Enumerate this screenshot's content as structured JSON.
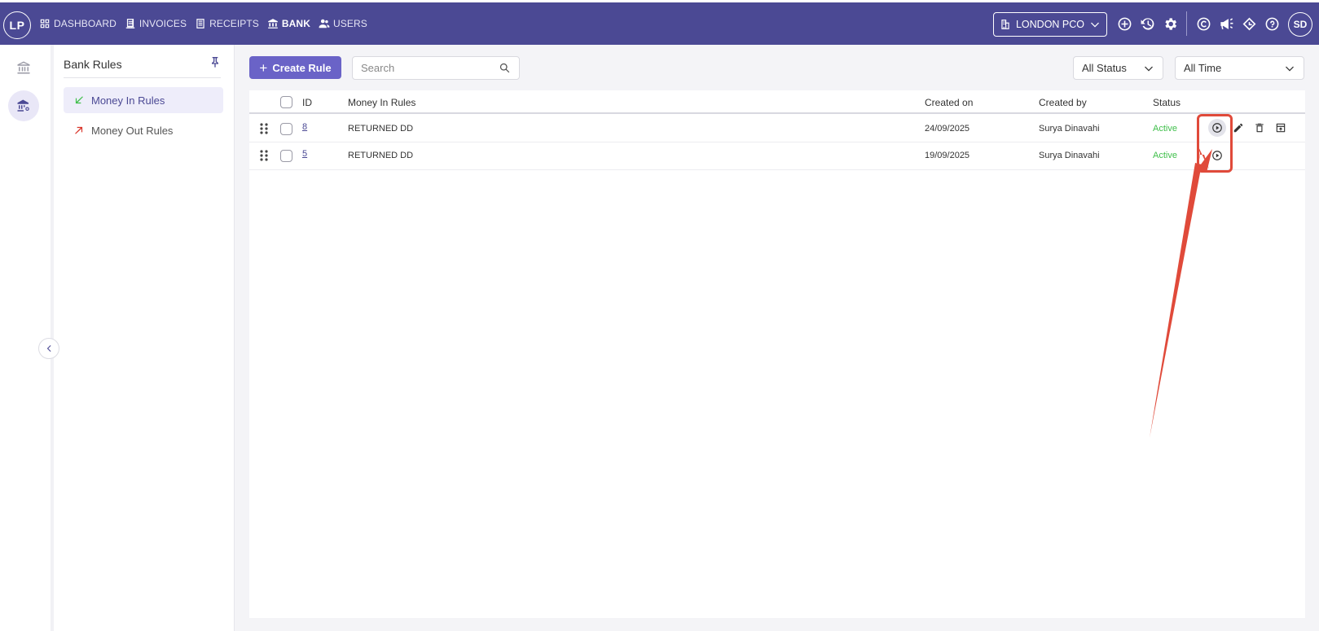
{
  "app": {
    "logo_text": "LP",
    "avatar_text": "SD"
  },
  "nav": {
    "items": [
      {
        "label": "DASHBOARD",
        "icon": "dashboard-icon",
        "active": false
      },
      {
        "label": "INVOICES",
        "icon": "invoice-icon",
        "active": false
      },
      {
        "label": "RECEIPTS",
        "icon": "receipt-icon",
        "active": false
      },
      {
        "label": "BANK",
        "icon": "bank-icon",
        "active": true
      },
      {
        "label": "USERS",
        "icon": "users-icon",
        "active": false
      }
    ]
  },
  "company": {
    "label": "LONDON PCO",
    "icon": "building-icon"
  },
  "top_icons": [
    "add-circle-icon",
    "history-icon",
    "settings-icon",
    "currency-icon",
    "announcement-icon",
    "diamond-icon",
    "help-icon"
  ],
  "rail": {
    "items": [
      "bank-icon",
      "bank-settings-icon"
    ]
  },
  "panel": {
    "title": "Bank Rules",
    "items": [
      {
        "label": "Money In Rules",
        "icon": "arrow-down-left-icon",
        "color": "#3fbf4a",
        "active": true
      },
      {
        "label": "Money Out Rules",
        "icon": "arrow-up-right-icon",
        "color": "#d9362b",
        "active": false
      }
    ]
  },
  "toolbar": {
    "create_label": "Create Rule",
    "search_placeholder": "Search",
    "status_filter": "All Status",
    "time_filter": "All Time"
  },
  "table": {
    "headers": {
      "id": "ID",
      "name": "Money In Rules",
      "created_on": "Created on",
      "created_by": "Created by",
      "status": "Status"
    },
    "rows": [
      {
        "id": "8",
        "name": "RETURNED DD",
        "created_on": "24/09/2025",
        "created_by": "Surya Dinavahi",
        "status": "Active"
      },
      {
        "id": "5",
        "name": "RETURNED DD",
        "created_on": "19/09/2025",
        "created_by": "Surya Dinavahi",
        "status": "Active"
      }
    ]
  },
  "colors": {
    "brand": "#4b4994",
    "primary_button": "#6a63c7",
    "active_status": "#3fbf4a",
    "annotation": "#e04a3a"
  }
}
